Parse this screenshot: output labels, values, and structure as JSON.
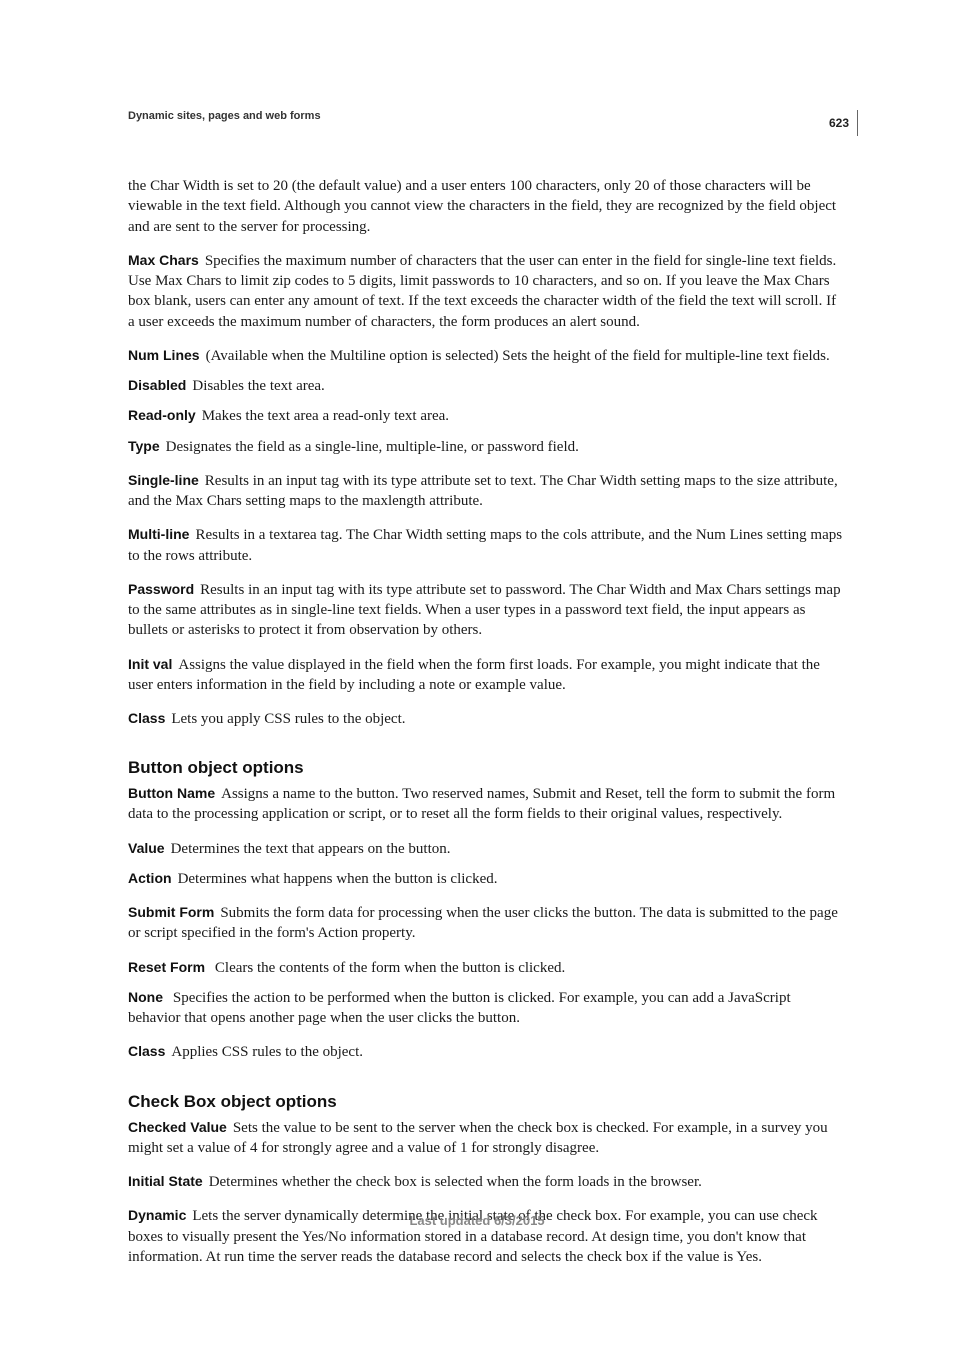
{
  "page_number": "623",
  "running_header": "Dynamic sites, pages and web forms",
  "intro_para": "the Char Width is set to 20 (the default value) and a user enters 100 characters, only 20 of those characters will be viewable in the text field. Although you cannot view the characters in the field, they are recognized by the field object and are sent to the server for processing.",
  "defs": {
    "max_chars": {
      "term": "Max Chars",
      "text": "Specifies the maximum number of characters that the user can enter in the field for single-line text fields. Use Max Chars to limit zip codes to 5 digits, limit passwords to 10 characters, and so on. If you leave the Max Chars box blank, users can enter any amount of text. If the text exceeds the character width of the field the text will scroll. If a user exceeds the maximum number of characters, the form produces an alert sound."
    },
    "num_lines": {
      "term": "Num Lines",
      "text": "(Available when the Multiline option is selected) Sets the height of the field for multiple-line text fields."
    },
    "disabled": {
      "term": "Disabled",
      "text": "Disables the text area."
    },
    "read_only": {
      "term": "Read-only",
      "text": "Makes the text area a read-only text area."
    },
    "type": {
      "term": "Type",
      "text": "Designates the field as a single-line, multiple-line, or password field."
    },
    "single_line": {
      "term": "Single-line",
      "text": "Results in an input tag with its type attribute set to text. The Char Width setting maps to the size attribute, and the Max Chars setting maps to the maxlength attribute."
    },
    "multi_line": {
      "term": "Multi-line",
      "text": "Results in a textarea tag. The Char Width setting maps to the cols attribute, and the Num Lines setting maps to the rows attribute."
    },
    "password": {
      "term": "Password",
      "text": "Results in an input tag with its type attribute set to password. The Char Width and Max Chars settings map to the same attributes as in single-line text fields. When a user types in a password text field, the input appears as bullets or asterisks to protect it from observation by others."
    },
    "init_val": {
      "term": "Init val",
      "text": "Assigns the value displayed in the field when the form first loads. For example, you might indicate that the user enters information in the field by including a note or example value."
    },
    "class1": {
      "term": "Class",
      "text": "Lets you apply CSS rules to the object."
    }
  },
  "button_heading": "Button object options",
  "button_defs": {
    "button_name": {
      "term": "Button Name",
      "text": "Assigns a name to the button. Two reserved names, Submit and Reset, tell the form to submit the form data to the processing application or script, or to reset all the form fields to their original values, respectively."
    },
    "value": {
      "term": "Value",
      "text": "Determines the text that appears on the button."
    },
    "action": {
      "term": "Action",
      "text": "Determines what happens when the button is clicked."
    },
    "submit_form": {
      "term": "Submit Form",
      "text": "Submits the form data for processing when the user clicks the button. The data is submitted to the page or script specified in the form's Action property."
    },
    "reset_form": {
      "term": "Reset Form ",
      "text": "Clears the contents of the form when the button is clicked."
    },
    "none": {
      "term": "None ",
      "text": "Specifies the action to be performed when the button is clicked. For example, you can add a JavaScript behavior that opens another page when the user clicks the button."
    },
    "class2": {
      "term": "Class",
      "text": "Applies CSS rules to the object."
    }
  },
  "checkbox_heading": "Check Box object options",
  "checkbox_defs": {
    "checked_value": {
      "term": "Checked Value",
      "text": "Sets the value to be sent to the server when the check box is checked. For example, in a survey you might set a value of 4 for strongly agree and a value of 1 for strongly disagree."
    },
    "initial_state": {
      "term": "Initial State",
      "text": "Determines whether the check box is selected when the form loads in the browser."
    },
    "dynamic": {
      "term": "Dynamic",
      "text": "Lets the server dynamically determine the initial state of the check box. For example, you can use check boxes to visually present the Yes/No information stored in a database record. At design time, you don't know that information. At run time the server reads the database record and selects the check box if the value is Yes."
    }
  },
  "footer": "Last updated 6/3/2015"
}
